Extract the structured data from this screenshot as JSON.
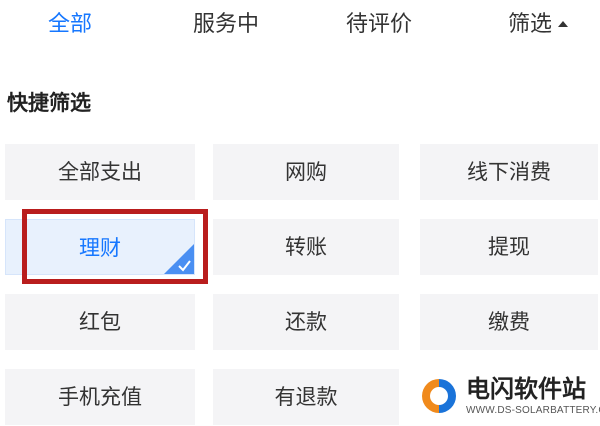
{
  "tabs": [
    {
      "label": "全部",
      "active": true
    },
    {
      "label": "服务中",
      "active": false
    },
    {
      "label": "待评价",
      "active": false
    },
    {
      "label": "筛选",
      "active": false,
      "icon": "caret-up-icon"
    }
  ],
  "quick_filter": {
    "title": "快捷筛选",
    "options": [
      {
        "label": "全部支出",
        "selected": false
      },
      {
        "label": "网购",
        "selected": false
      },
      {
        "label": "线下消费",
        "selected": false
      },
      {
        "label": "理财",
        "selected": true
      },
      {
        "label": "转账",
        "selected": false
      },
      {
        "label": "提现",
        "selected": false
      },
      {
        "label": "红包",
        "selected": false
      },
      {
        "label": "还款",
        "selected": false
      },
      {
        "label": "缴费",
        "selected": false
      },
      {
        "label": "手机充值",
        "selected": false
      },
      {
        "label": "有退款",
        "selected": false
      }
    ]
  },
  "watermark": {
    "title": "电闪软件站",
    "url": "WWW.DS-SOLARBATTERY.COM"
  },
  "colors": {
    "accent": "#1677ff",
    "selected_bg": "#e8f1fd",
    "chip_bg": "#f4f4f6",
    "highlight_box": "#b91d1d"
  }
}
